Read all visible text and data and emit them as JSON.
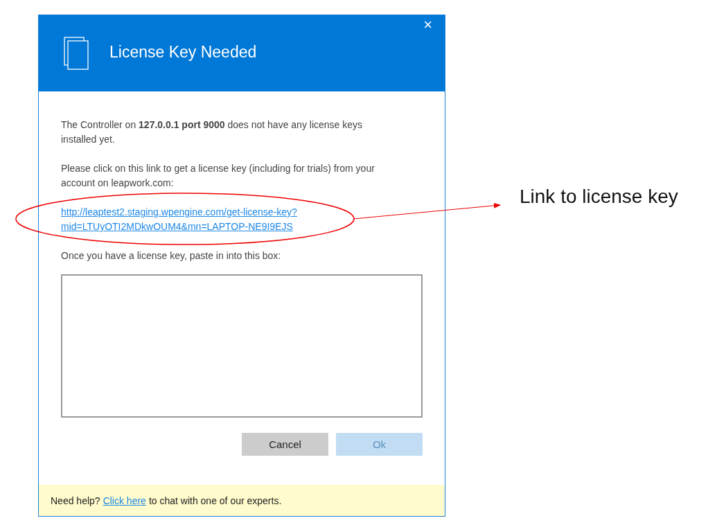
{
  "dialog": {
    "title": "License Key Needed",
    "close": "×",
    "message": "The Controller on **127.0.0.1 port 9000** does not have any license keys installed yet.",
    "instruction": "Please click on this link to get a license key (including for trials) from your account on leapwork.com:",
    "link_lines": [
      "http://leaptest2.staging.wpengine.com/get-license-key?",
      "mid=LTUyOTI2MDkwOUM4&mn=LAPTOP-NE9I9EJS"
    ],
    "paste_label": "Once you have a license key, paste in into this box:",
    "buttons": [
      {
        "label": "Cancel",
        "disabled": false
      },
      {
        "label": "Ok",
        "disabled": true
      }
    ],
    "footer": {
      "prefix": "Need help?",
      "link": "Click here",
      "suffix": "to chat with one of our experts."
    }
  },
  "annotation": {
    "label": "Link to license key"
  }
}
